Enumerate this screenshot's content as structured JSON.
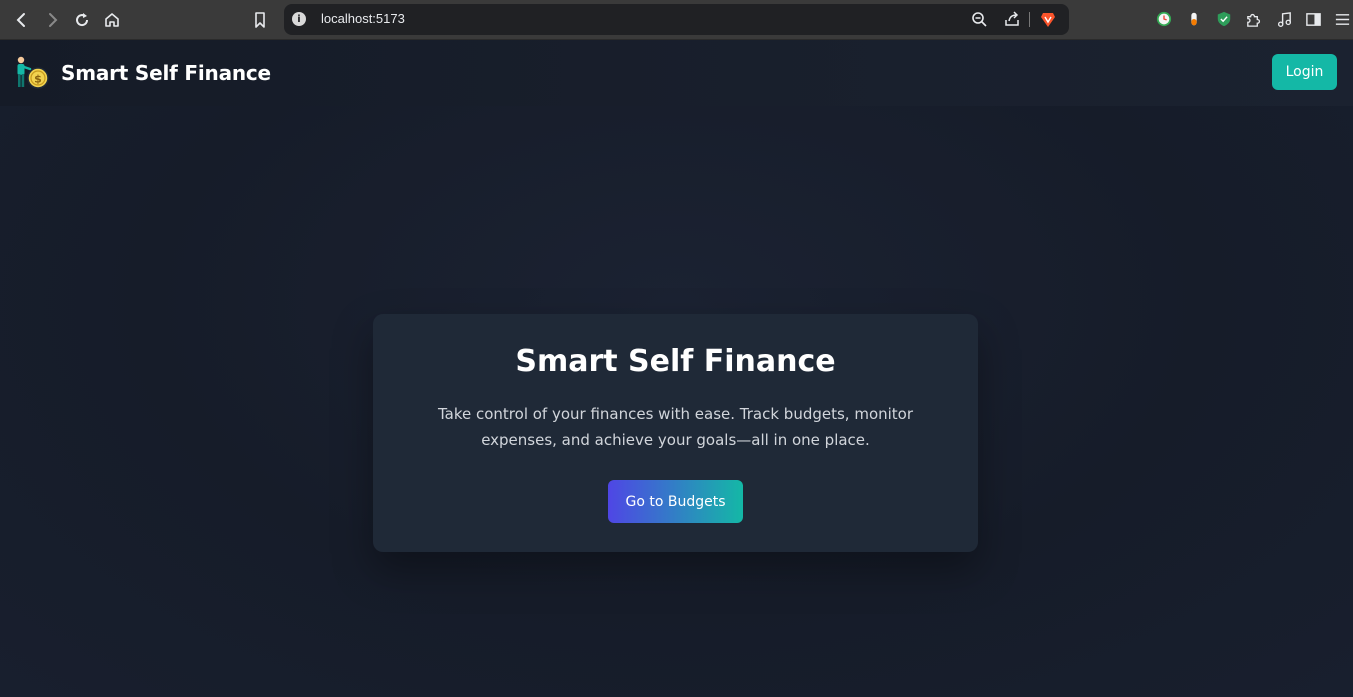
{
  "browser": {
    "url": "localhost:5173",
    "info_icon_glyph": "i"
  },
  "app": {
    "brand": "Smart Self Finance",
    "login_label": "Login",
    "hero": {
      "title": "Smart Self Finance",
      "description": "Take control of your finances with ease. Track budgets, monitor expenses, and achieve your goals—all in one place.",
      "cta_label": "Go to Budgets"
    }
  },
  "colors": {
    "accent_teal": "#14b8a6",
    "accent_indigo": "#4f46e5",
    "card_bg": "#1f2937",
    "page_bg": "#161c29"
  }
}
